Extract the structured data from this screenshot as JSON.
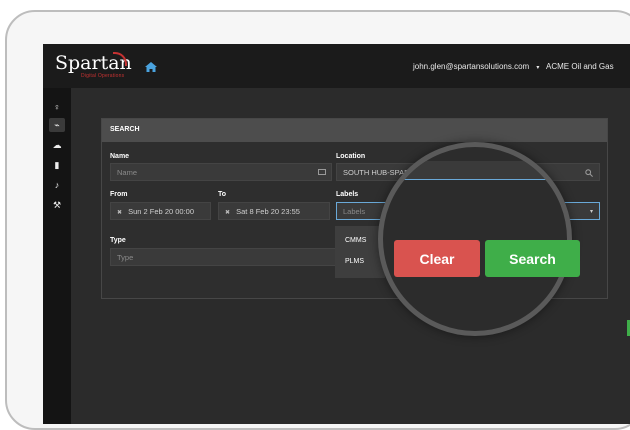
{
  "header": {
    "logo_text": "Spartan",
    "logo_sub": "Digital Operations",
    "user_email": "john.glen@spartansolutions.com",
    "user_caret": "▾",
    "organization": "ACME Oil and Gas"
  },
  "sidebar": {
    "items": [
      {
        "icon": "lightbulb-icon",
        "glyph": "♀"
      },
      {
        "icon": "chart-icon",
        "glyph": "⌁"
      },
      {
        "icon": "users-icon",
        "glyph": "☁"
      },
      {
        "icon": "thermometer-icon",
        "glyph": "▮"
      },
      {
        "icon": "bell-icon",
        "glyph": "♪"
      },
      {
        "icon": "wrench-icon",
        "glyph": "⚒"
      }
    ]
  },
  "search_panel": {
    "title": "SEARCH",
    "name_label": "Name",
    "name_placeholder": "Name",
    "location_label": "Location",
    "location_value": "SOUTH HUB-SPARTA",
    "from_label": "From",
    "from_value": "Sun 2 Feb 20  00:00",
    "to_label": "To",
    "to_value": "Sat 8 Feb 20  23:55",
    "labels_label": "Labels",
    "labels_placeholder": "Labels",
    "labels_options": [
      "CMMS",
      "PLMS"
    ],
    "type_label": "Type",
    "type_placeholder": "Type",
    "clear_x": "✖"
  },
  "actions": {
    "clear_label": "Clear",
    "search_label": "Search"
  },
  "colors": {
    "clear": "#d9534f",
    "search": "#3fae49",
    "brand_red": "#c63232",
    "home_blue": "#4aa3df"
  }
}
